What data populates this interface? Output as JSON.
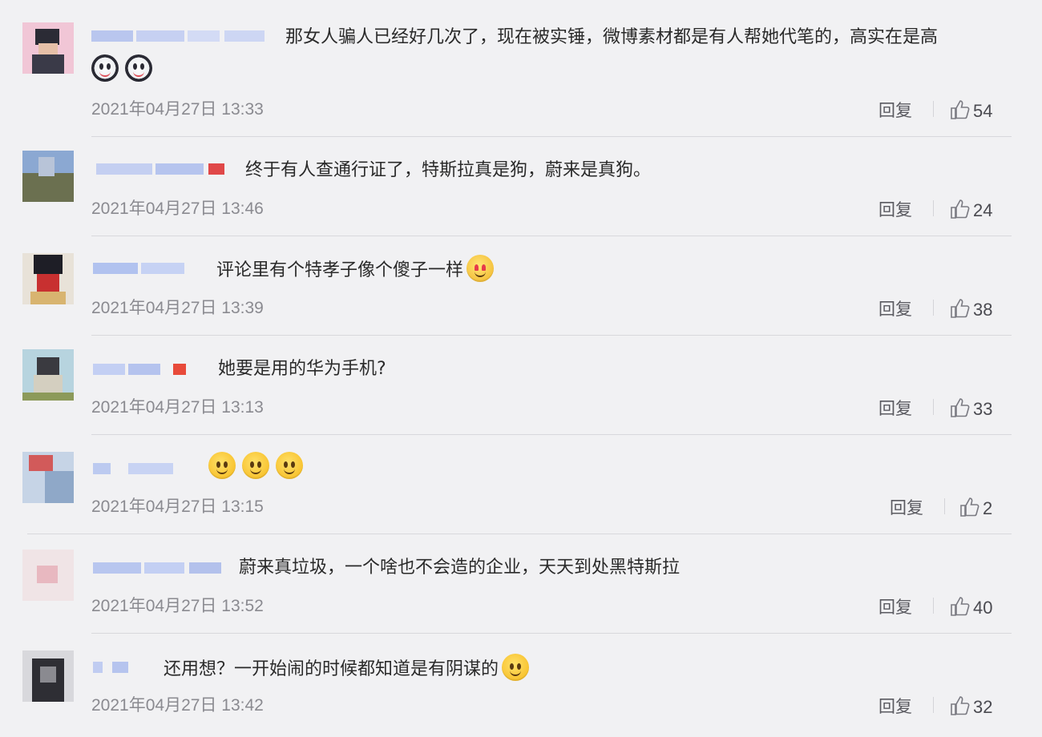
{
  "comments": [
    {
      "text": "那女人骗人已经好几次了，现在被实锤，微博素材都是有人帮她代笔的，高实在是高",
      "emojis": [
        "dog-emoji",
        "dog-emoji"
      ],
      "date": "2021年04月27日 13:33",
      "reply_label": "回复",
      "likes": "54"
    },
    {
      "text": "终于有人查通行证了，特斯拉真是狗，蔚来是真狗。",
      "emojis": [],
      "date": "2021年04月27日 13:46",
      "reply_label": "回复",
      "likes": "24"
    },
    {
      "text": "评论里有个特孝子像个傻子一样",
      "emojis": [
        "heart-eyes-emoji"
      ],
      "date": "2021年04月27日 13:39",
      "reply_label": "回复",
      "likes": "38"
    },
    {
      "text": "她要是用的华为手机?",
      "emojis": [],
      "date": "2021年04月27日 13:13",
      "reply_label": "回复",
      "likes": "33"
    },
    {
      "text": "",
      "emojis": [
        "thinking-emoji",
        "thinking-emoji",
        "thinking-emoji"
      ],
      "date": "2021年04月27日 13:15",
      "reply_label": "回复",
      "likes": "2"
    },
    {
      "text": "蔚来真垃圾，一个啥也不会造的企业，天天到处黑特斯拉",
      "emojis": [],
      "date": "2021年04月27日 13:52",
      "reply_label": "回复",
      "likes": "40"
    },
    {
      "text": "还用想？一开始闹的时候都知道是有阴谋的",
      "emojis": [
        "smile-emoji"
      ],
      "date": "2021年04月27日 13:42",
      "reply_label": "回复",
      "likes": "32"
    }
  ],
  "colors": {
    "background": "#f1f1f3",
    "date_text": "#8a8a90",
    "body_text": "#2a2a2a",
    "divider": "#d8d8dc"
  }
}
